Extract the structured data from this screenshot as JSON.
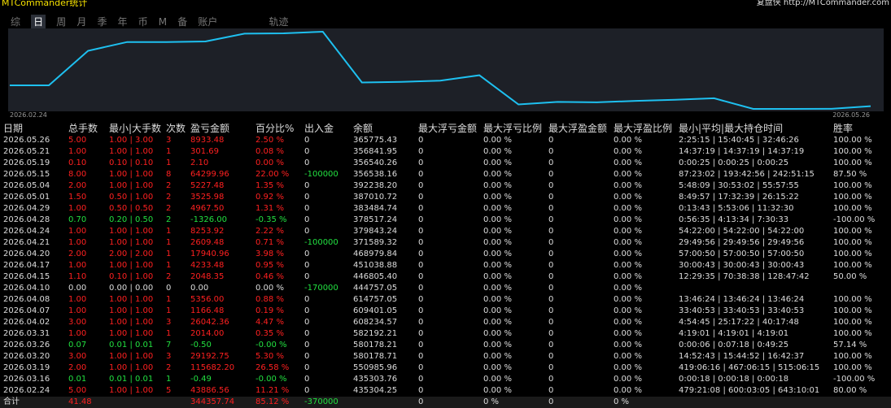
{
  "app": {
    "title": "MTCommander统计",
    "right_label": "复盘侠",
    "right_link": "http://MTCommander.com"
  },
  "tabs": [
    {
      "label": "综",
      "active": false
    },
    {
      "label": "日",
      "active": true
    },
    {
      "label": "周",
      "active": false
    },
    {
      "label": "月",
      "active": false
    },
    {
      "label": "季",
      "active": false
    },
    {
      "label": "年",
      "active": false
    },
    {
      "label": "币",
      "active": false
    },
    {
      "label": "M",
      "active": false
    },
    {
      "label": "备",
      "active": false
    },
    {
      "label": "账户",
      "active": false
    },
    {
      "label": "轨迹",
      "active": false
    }
  ],
  "chart_data": {
    "type": "line",
    "x_start_label": "2026.02.24",
    "x_end_label": "2026.05.26",
    "line_color": "#1ec0f0",
    "background": "#1d2027",
    "points_y": [
      435304.25,
      435303.76,
      550985.96,
      580178.71,
      580178.21,
      582192.21,
      608234.57,
      609401.05,
      614757.05,
      444757.05,
      446805.4,
      451038.88,
      468979.84,
      371589.32,
      379843.24,
      378517.24,
      383484.74,
      387010.72,
      392238.2,
      356538.16,
      356540.26,
      356841.95,
      365775.43
    ]
  },
  "table": {
    "headers": [
      "日期",
      "总手数",
      "最小|大手数",
      "次数",
      "盈亏金额",
      "百分比%",
      "出入金",
      "余额",
      "最大浮亏金额",
      "最大浮亏比例",
      "最大浮盈金额",
      "最大浮盈比例",
      "最小|平均|最大持仓时间",
      "胜率"
    ],
    "rows": [
      {
        "date": "2026.05.26",
        "lots": "5.00",
        "minmax": "1.00 | 3.00",
        "count": "3",
        "pnl": "8933.48",
        "pct": "2.50 %",
        "flow": "0",
        "balance": "365775.43",
        "maxloss": "0",
        "maxlossr": "0.00 %",
        "maxprofit": "0",
        "maxprofitr": "0.00 %",
        "hold": "2:25:15 | 15:40:45 | 32:46:26",
        "win": "100.00 %",
        "sign": "pos"
      },
      {
        "date": "2026.05.21",
        "lots": "1.00",
        "minmax": "1.00 | 1.00",
        "count": "1",
        "pnl": "301.69",
        "pct": "0.08 %",
        "flow": "0",
        "balance": "356841.95",
        "maxloss": "0",
        "maxlossr": "0.00 %",
        "maxprofit": "0",
        "maxprofitr": "0.00 %",
        "hold": "14:37:19 | 14:37:19 | 14:37:19",
        "win": "100.00 %",
        "sign": "pos"
      },
      {
        "date": "2026.05.19",
        "lots": "0.10",
        "minmax": "0.10 | 0.10",
        "count": "1",
        "pnl": "2.10",
        "pct": "0.00 %",
        "flow": "0",
        "balance": "356540.26",
        "maxloss": "0",
        "maxlossr": "0.00 %",
        "maxprofit": "0",
        "maxprofitr": "0.00 %",
        "hold": "0:00:25 | 0:00:25 | 0:00:25",
        "win": "100.00 %",
        "sign": "pos"
      },
      {
        "date": "2026.05.15",
        "lots": "8.00",
        "minmax": "1.00 | 1.00",
        "count": "8",
        "pnl": "64299.96",
        "pct": "22.00 %",
        "flow": "-100000",
        "balance": "356538.16",
        "maxloss": "0",
        "maxlossr": "0.00 %",
        "maxprofit": "0",
        "maxprofitr": "0.00 %",
        "hold": "87:23:02 | 193:42:56 | 242:51:15",
        "win": "87.50 %",
        "sign": "pos"
      },
      {
        "date": "2026.05.04",
        "lots": "2.00",
        "minmax": "1.00 | 1.00",
        "count": "2",
        "pnl": "5227.48",
        "pct": "1.35 %",
        "flow": "0",
        "balance": "392238.20",
        "maxloss": "0",
        "maxlossr": "0.00 %",
        "maxprofit": "0",
        "maxprofitr": "0.00 %",
        "hold": "5:48:09 | 30:53:02 | 55:57:55",
        "win": "100.00 %",
        "sign": "pos"
      },
      {
        "date": "2026.05.01",
        "lots": "1.50",
        "minmax": "0.50 | 1.00",
        "count": "2",
        "pnl": "3525.98",
        "pct": "0.92 %",
        "flow": "0",
        "balance": "387010.72",
        "maxloss": "0",
        "maxlossr": "0.00 %",
        "maxprofit": "0",
        "maxprofitr": "0.00 %",
        "hold": "8:49:57 | 17:32:39 | 26:15:22",
        "win": "100.00 %",
        "sign": "pos"
      },
      {
        "date": "2026.04.29",
        "lots": "1.00",
        "minmax": "0.50 | 0.50",
        "count": "2",
        "pnl": "4967.50",
        "pct": "1.31 %",
        "flow": "0",
        "balance": "383484.74",
        "maxloss": "0",
        "maxlossr": "0.00 %",
        "maxprofit": "0",
        "maxprofitr": "0.00 %",
        "hold": "0:13:43 | 5:53:06 | 11:32:30",
        "win": "100.00 %",
        "sign": "pos"
      },
      {
        "date": "2026.04.28",
        "lots": "0.70",
        "minmax": "0.20 | 0.50",
        "count": "2",
        "pnl": "-1326.00",
        "pct": "-0.35 %",
        "flow": "0",
        "balance": "378517.24",
        "maxloss": "0",
        "maxlossr": "0.00 %",
        "maxprofit": "0",
        "maxprofitr": "0.00 %",
        "hold": "0:56:35 | 4:13:34 | 7:30:33",
        "win": "-100.00 %",
        "sign": "neg"
      },
      {
        "date": "2026.04.24",
        "lots": "1.00",
        "minmax": "1.00 | 1.00",
        "count": "1",
        "pnl": "8253.92",
        "pct": "2.22 %",
        "flow": "0",
        "balance": "379843.24",
        "maxloss": "0",
        "maxlossr": "0.00 %",
        "maxprofit": "0",
        "maxprofitr": "0.00 %",
        "hold": "54:22:00 | 54:22:00 | 54:22:00",
        "win": "100.00 %",
        "sign": "pos"
      },
      {
        "date": "2026.04.21",
        "lots": "1.00",
        "minmax": "1.00 | 1.00",
        "count": "1",
        "pnl": "2609.48",
        "pct": "0.71 %",
        "flow": "-100000",
        "balance": "371589.32",
        "maxloss": "0",
        "maxlossr": "0.00 %",
        "maxprofit": "0",
        "maxprofitr": "0.00 %",
        "hold": "29:49:56 | 29:49:56 | 29:49:56",
        "win": "100.00 %",
        "sign": "pos"
      },
      {
        "date": "2026.04.20",
        "lots": "2.00",
        "minmax": "2.00 | 2.00",
        "count": "1",
        "pnl": "17940.96",
        "pct": "3.98 %",
        "flow": "0",
        "balance": "468979.84",
        "maxloss": "0",
        "maxlossr": "0.00 %",
        "maxprofit": "0",
        "maxprofitr": "0.00 %",
        "hold": "57:00:50 | 57:00:50 | 57:00:50",
        "win": "100.00 %",
        "sign": "pos"
      },
      {
        "date": "2026.04.17",
        "lots": "1.00",
        "minmax": "1.00 | 1.00",
        "count": "1",
        "pnl": "4233.48",
        "pct": "0.95 %",
        "flow": "0",
        "balance": "451038.88",
        "maxloss": "0",
        "maxlossr": "0.00 %",
        "maxprofit": "0",
        "maxprofitr": "0.00 %",
        "hold": "30:00:43 | 30:00:43 | 30:00:43",
        "win": "100.00 %",
        "sign": "pos"
      },
      {
        "date": "2026.04.15",
        "lots": "1.10",
        "minmax": "0.10 | 1.00",
        "count": "2",
        "pnl": "2048.35",
        "pct": "0.46 %",
        "flow": "0",
        "balance": "446805.40",
        "maxloss": "0",
        "maxlossr": "0.00 %",
        "maxprofit": "0",
        "maxprofitr": "0.00 %",
        "hold": "12:29:35 | 70:38:38 | 128:47:42",
        "win": "50.00 %",
        "sign": "pos"
      },
      {
        "date": "2026.04.10",
        "lots": "0.00",
        "minmax": "0.00 | 0.00",
        "count": "0",
        "pnl": "0.00",
        "pct": "0.00 %",
        "flow": "-170000",
        "balance": "444757.05",
        "maxloss": "0",
        "maxlossr": "0.00 %",
        "maxprofit": "0",
        "maxprofitr": "0.00 %",
        "hold": "",
        "win": "",
        "sign": "zero"
      },
      {
        "date": "2026.04.08",
        "lots": "1.00",
        "minmax": "1.00 | 1.00",
        "count": "1",
        "pnl": "5356.00",
        "pct": "0.88 %",
        "flow": "0",
        "balance": "614757.05",
        "maxloss": "0",
        "maxlossr": "0.00 %",
        "maxprofit": "0",
        "maxprofitr": "0.00 %",
        "hold": "13:46:24 | 13:46:24 | 13:46:24",
        "win": "100.00 %",
        "sign": "pos"
      },
      {
        "date": "2026.04.07",
        "lots": "1.00",
        "minmax": "1.00 | 1.00",
        "count": "1",
        "pnl": "1166.48",
        "pct": "0.19 %",
        "flow": "0",
        "balance": "609401.05",
        "maxloss": "0",
        "maxlossr": "0.00 %",
        "maxprofit": "0",
        "maxprofitr": "0.00 %",
        "hold": "33:40:53 | 33:40:53 | 33:40:53",
        "win": "100.00 %",
        "sign": "pos"
      },
      {
        "date": "2026.04.02",
        "lots": "3.00",
        "minmax": "1.00 | 1.00",
        "count": "3",
        "pnl": "26042.36",
        "pct": "4.47 %",
        "flow": "0",
        "balance": "608234.57",
        "maxloss": "0",
        "maxlossr": "0.00 %",
        "maxprofit": "0",
        "maxprofitr": "0.00 %",
        "hold": "4:54:45 | 25:17:22 | 40:17:48",
        "win": "100.00 %",
        "sign": "pos"
      },
      {
        "date": "2026.03.31",
        "lots": "1.00",
        "minmax": "1.00 | 1.00",
        "count": "1",
        "pnl": "2014.00",
        "pct": "0.35 %",
        "flow": "0",
        "balance": "582192.21",
        "maxloss": "0",
        "maxlossr": "0.00 %",
        "maxprofit": "0",
        "maxprofitr": "0.00 %",
        "hold": "4:19:01 | 4:19:01 | 4:19:01",
        "win": "100.00 %",
        "sign": "pos"
      },
      {
        "date": "2026.03.26",
        "lots": "0.07",
        "minmax": "0.01 | 0.01",
        "count": "7",
        "pnl": "-0.50",
        "pct": "-0.00 %",
        "flow": "0",
        "balance": "580178.21",
        "maxloss": "0",
        "maxlossr": "0.00 %",
        "maxprofit": "0",
        "maxprofitr": "0.00 %",
        "hold": "0:00:06 | 0:07:18 | 0:49:25",
        "win": "57.14 %",
        "sign": "neg"
      },
      {
        "date": "2026.03.20",
        "lots": "3.00",
        "minmax": "1.00 | 1.00",
        "count": "3",
        "pnl": "29192.75",
        "pct": "5.30 %",
        "flow": "0",
        "balance": "580178.71",
        "maxloss": "0",
        "maxlossr": "0.00 %",
        "maxprofit": "0",
        "maxprofitr": "0.00 %",
        "hold": "14:52:43 | 15:44:52 | 16:42:37",
        "win": "100.00 %",
        "sign": "pos"
      },
      {
        "date": "2026.03.19",
        "lots": "2.00",
        "minmax": "1.00 | 1.00",
        "count": "2",
        "pnl": "115682.20",
        "pct": "26.58 %",
        "flow": "0",
        "balance": "550985.96",
        "maxloss": "0",
        "maxlossr": "0.00 %",
        "maxprofit": "0",
        "maxprofitr": "0.00 %",
        "hold": "419:06:16 | 467:06:15 | 515:06:15",
        "win": "100.00 %",
        "sign": "pos"
      },
      {
        "date": "2026.03.16",
        "lots": "0.01",
        "minmax": "0.01 | 0.01",
        "count": "1",
        "pnl": "-0.49",
        "pct": "-0.00 %",
        "flow": "0",
        "balance": "435303.76",
        "maxloss": "0",
        "maxlossr": "0.00 %",
        "maxprofit": "0",
        "maxprofitr": "0.00 %",
        "hold": "0:00:18 | 0:00:18 | 0:00:18",
        "win": "-100.00 %",
        "sign": "neg"
      },
      {
        "date": "2026.02.24",
        "lots": "5.00",
        "minmax": "1.00 | 1.00",
        "count": "5",
        "pnl": "43886.56",
        "pct": "11.21 %",
        "flow": "0",
        "balance": "435304.25",
        "maxloss": "0",
        "maxlossr": "0.00 %",
        "maxprofit": "0",
        "maxprofitr": "0.00 %",
        "hold": "479:21:08 | 600:03:05 | 643:10:01",
        "win": "80.00 %",
        "sign": "pos"
      }
    ],
    "total": {
      "date": "合计",
      "lots": "41.48",
      "pnl": "344357.74",
      "pct": "85.12 %",
      "flow": "-370000",
      "maxloss": "0",
      "maxlossr": "0 %",
      "maxprofit": "0",
      "maxprofitr": "0 %"
    }
  }
}
